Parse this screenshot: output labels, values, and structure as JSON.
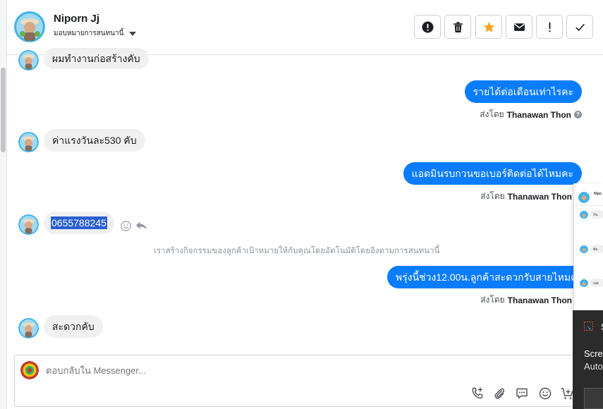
{
  "header": {
    "name": "Niporn Jj",
    "assign_label": "มอบหมายการสนทนานี้"
  },
  "toolbar": {
    "buttons": [
      {
        "icon": "alert-circle-icon"
      },
      {
        "icon": "trash-icon"
      },
      {
        "icon": "star-icon"
      },
      {
        "icon": "envelope-icon"
      },
      {
        "icon": "exclamation-icon"
      },
      {
        "icon": "check-icon"
      }
    ]
  },
  "messages": {
    "m1": "ผมทำงานก่อสร้างคับ",
    "m2": "รายได้ต่อเดือนเท่าไรคะ",
    "m2_sentby_prefix": "ส่งโดย",
    "m2_sentby_name": "Thanawan Thon",
    "m3": "ค่าแรงวันละ530  คับ",
    "m4": "แอดมินรบกวนขอเบอร์ติดต่อได้ไหมคะ",
    "m4_sentby_prefix": "ส่งโดย",
    "m4_sentby_name": "Thanawan Thon",
    "m5": "0655788245",
    "system_note": "เราสร้างกิจกรรมของลูกค้าเป้าหมายให้กับคุณโดยอัตโนมัติโดยอิงตามการสนทนานี้",
    "m6": "พรุ่งนี้ช่วง12.00น.ลูกค้าสะดวกรับสายไหมคะ",
    "m6_sentby_prefix": "ส่งโดย",
    "m6_sentby_name": "Thanawan Thon",
    "m7": "สะดวกคับ"
  },
  "composer": {
    "placeholder": "ตอบกลับใน Messenger..."
  },
  "mini_panel": {
    "name": "Nipo",
    "t1": "กัน",
    "t2": "ซัด",
    "t3": "เผล"
  },
  "popup": {
    "title_initial": "S",
    "line1": "Scre",
    "line2": "Auto"
  },
  "colors": {
    "outgoing_bubble": "#0a7cff",
    "incoming_bubble": "#f0f0f0",
    "star": "#f5a623"
  }
}
